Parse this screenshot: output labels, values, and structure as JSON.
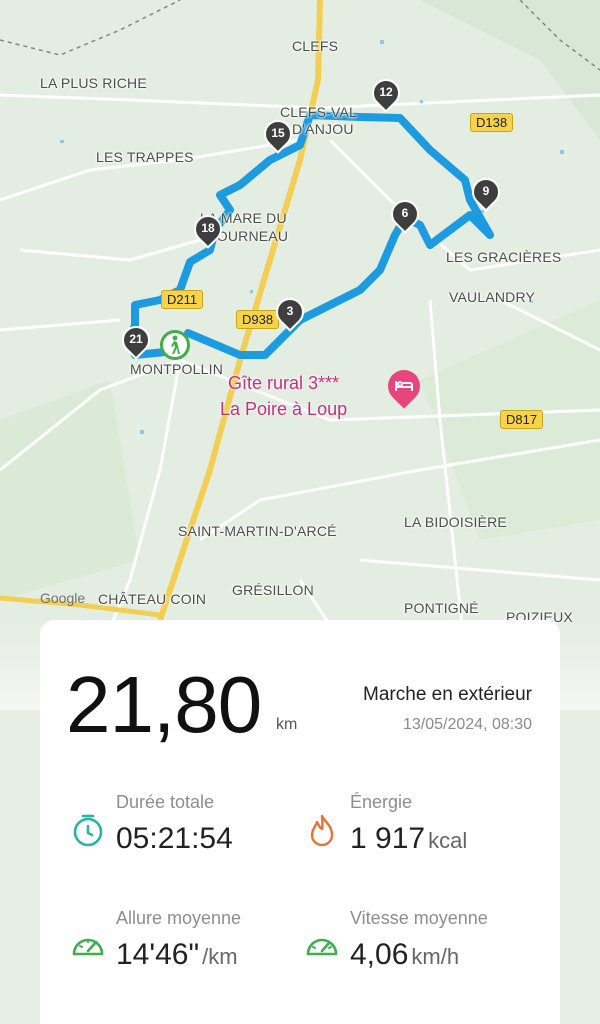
{
  "map": {
    "places": {
      "clefs": "CLEFS",
      "la_plus_riche": "LA PLUS RICHE",
      "clefs_val_1": "CLEFS-VAL",
      "clefs_val_2": "D'ANJOU",
      "les_trappes": "LES TRAPPES",
      "mare_1": "LA MARE DU",
      "mare_2": "FOURNEAU",
      "les_gracieres": "LES GRACIÈRES",
      "vaulandry": "VAULANDRY",
      "montpollin": "MONTPOLLIN",
      "saint_martin": "SAINT-MARTIN-D'ARCÉ",
      "la_bidoisiere": "LA BIDOISIÈRE",
      "gresillon": "GRÉSILLON",
      "chateau_coin": "CHÂTEAU COIN",
      "pontigne": "PONTIGNÉ",
      "poizieux": "POIZIEUX"
    },
    "roads": {
      "d138": "D138",
      "d211": "D211",
      "d938": "D938",
      "d817": "D817"
    },
    "markers": {
      "m3": "3",
      "m6": "6",
      "m9": "9",
      "m12": "12",
      "m15": "15",
      "m18": "18",
      "m21": "21"
    },
    "poi": {
      "line1": "Gîte rural 3***",
      "line2": "La Poire à Loup",
      "icon": "bed-icon"
    },
    "attribution": "Google",
    "start_icon": "hiker-icon"
  },
  "summary": {
    "distance": "21,80",
    "distance_unit": "km",
    "activity": "Marche en extérieur",
    "datetime": "13/05/2024, 08:30"
  },
  "stats": {
    "duration": {
      "label": "Durée totale",
      "value": "05:21:54",
      "icon": "stopwatch-icon"
    },
    "energy": {
      "label": "Énergie",
      "value": "1 917",
      "unit": "kcal",
      "icon": "flame-icon"
    },
    "pace": {
      "label": "Allure moyenne",
      "value": "14'46\"",
      "unit": "/km",
      "icon": "gauge-icon"
    },
    "speed": {
      "label": "Vitesse moyenne",
      "value": "4,06",
      "unit": "km/h",
      "icon": "speedometer-icon"
    }
  },
  "colors": {
    "route": "#1d9be0",
    "green": "#3fae4b",
    "orange": "#e4733a",
    "teal": "#27b5a3",
    "poi": "#c2307b"
  }
}
